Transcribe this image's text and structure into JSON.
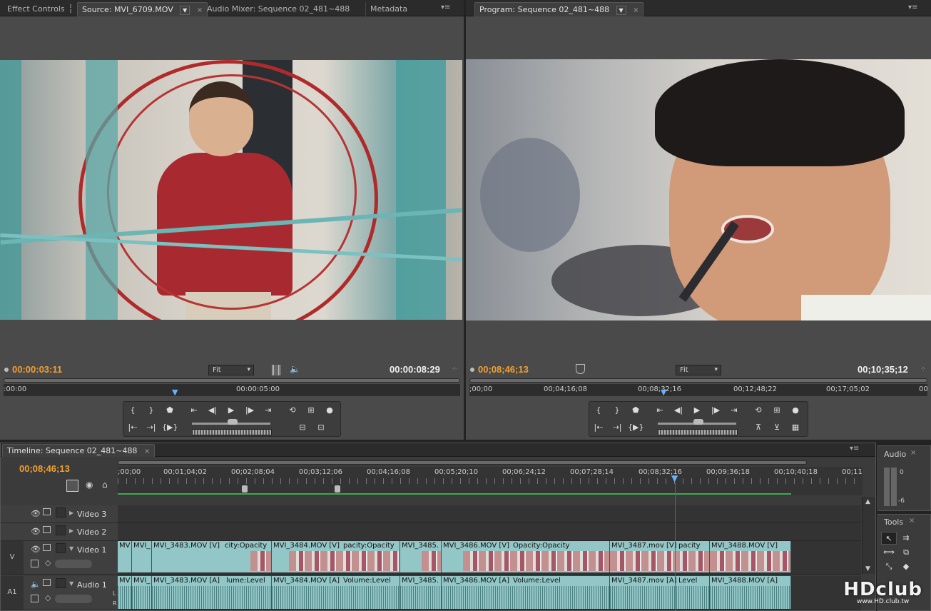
{
  "top_tabs_left": {
    "effect_controls": "Effect Controls",
    "source": "Source: MVI_6709.MOV",
    "audio_mixer": "Audio Mixer: Sequence 02_481~488",
    "metadata": "Metadata"
  },
  "top_tabs_right": {
    "program": "Program: Sequence 02_481~488"
  },
  "source_monitor": {
    "current_tc": "00:00:03:11",
    "duration_tc": "00:00:08:29",
    "zoom": "Fit",
    "ruler_ticks": [
      ":00:00",
      "00:00:05:00"
    ]
  },
  "program_monitor": {
    "current_tc": "00;08;46;13",
    "duration_tc": "00;10;35;12",
    "zoom": "Fit",
    "ruler_ticks": [
      ";00;00",
      "00;04;16;08",
      "00;08;32;16",
      "00;12;48;22",
      "00;17;05;02",
      "00"
    ]
  },
  "timeline": {
    "tab": "Timeline: Sequence 02_481~488",
    "current_tc": "00;08;46;13",
    "ruler_ticks": [
      ";00;00",
      "00;01;04;02",
      "00;02;08;04",
      "00;03;12;06",
      "00;04;16;08",
      "00;05;20;10",
      "00;06;24;12",
      "00;07;28;14",
      "00;08;32;16",
      "00;09;36;18",
      "00;10;40;18",
      "00;11"
    ],
    "tracks": {
      "video3": "Video 3",
      "video2": "Video 2",
      "video1": "Video 1",
      "audio1": "Audio 1",
      "v_target": "V",
      "a_target": "A1"
    },
    "video_clips": [
      "MV",
      "MVI_",
      "MVI_3483.MOV [V]",
      "city:Opacity",
      "MVI_3484.MOV [V]",
      "pacity:Opacity",
      "MVI_3485.",
      "MVI_3486.MOV [V]",
      "Opacity:Opacity",
      "MVI_3487.mov [V]",
      "pacity",
      "MVI_3488.MOV [V]"
    ],
    "audio_clips": [
      "MV",
      "MVI_",
      "MVI_3483.MOV [A]",
      "lume:Level",
      "MVI_3484.MOV [A]",
      "Volume:Level",
      "MVI_3485.",
      "MVI_3486.MOV [A]",
      "Volume:Level",
      "MVI_3487.mov [A]",
      "Level",
      "MVI_3488.MOV [A]"
    ],
    "audio_lr": [
      "L",
      "R"
    ]
  },
  "audio_panel": {
    "title": "Audio",
    "meter_top": "0",
    "meter_mid": "-6"
  },
  "tools_panel": {
    "title": "Tools"
  },
  "watermark": {
    "text": "HDclub",
    "sub": "www.HD.club.tw"
  }
}
